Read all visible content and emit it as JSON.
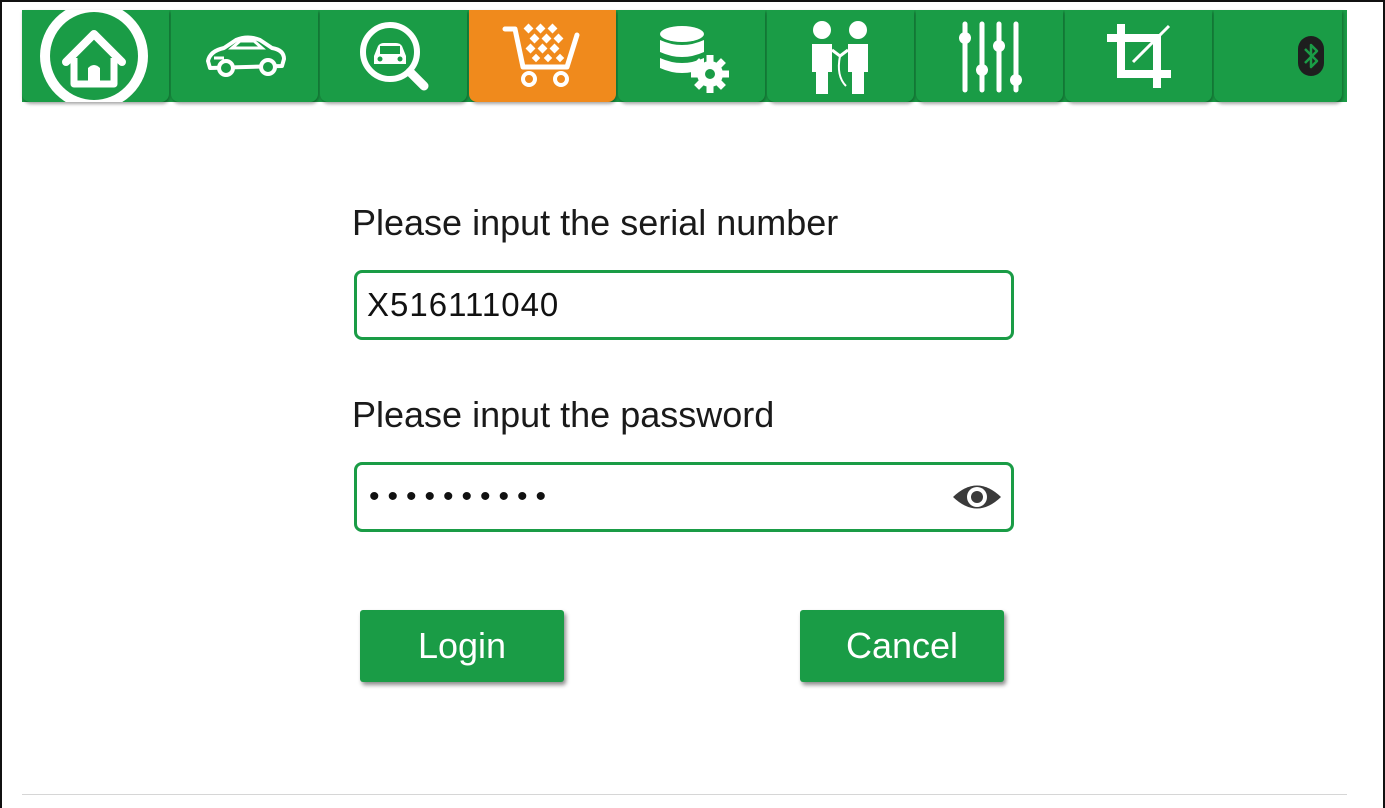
{
  "toolbar": {
    "tabs": [
      {
        "id": "home",
        "icon": "home-icon"
      },
      {
        "id": "vehicle",
        "icon": "car-icon"
      },
      {
        "id": "diagnose",
        "icon": "car-search-icon"
      },
      {
        "id": "shop",
        "icon": "shopping-cart-icon",
        "active": true
      },
      {
        "id": "data-settings",
        "icon": "database-gear-icon"
      },
      {
        "id": "support",
        "icon": "people-icon"
      },
      {
        "id": "settings",
        "icon": "sliders-icon"
      },
      {
        "id": "crop",
        "icon": "crop-icon"
      },
      {
        "id": "bluetooth",
        "icon": "bluetooth-icon"
      }
    ],
    "colors": {
      "bar": "#1a9c46",
      "active": "#f08a1c"
    }
  },
  "form": {
    "serial_label": "Please input the serial number",
    "serial_value": "X516111040",
    "password_label": "Please input the password",
    "password_mask": "••••••••••",
    "login_label": "Login",
    "cancel_label": "Cancel"
  }
}
